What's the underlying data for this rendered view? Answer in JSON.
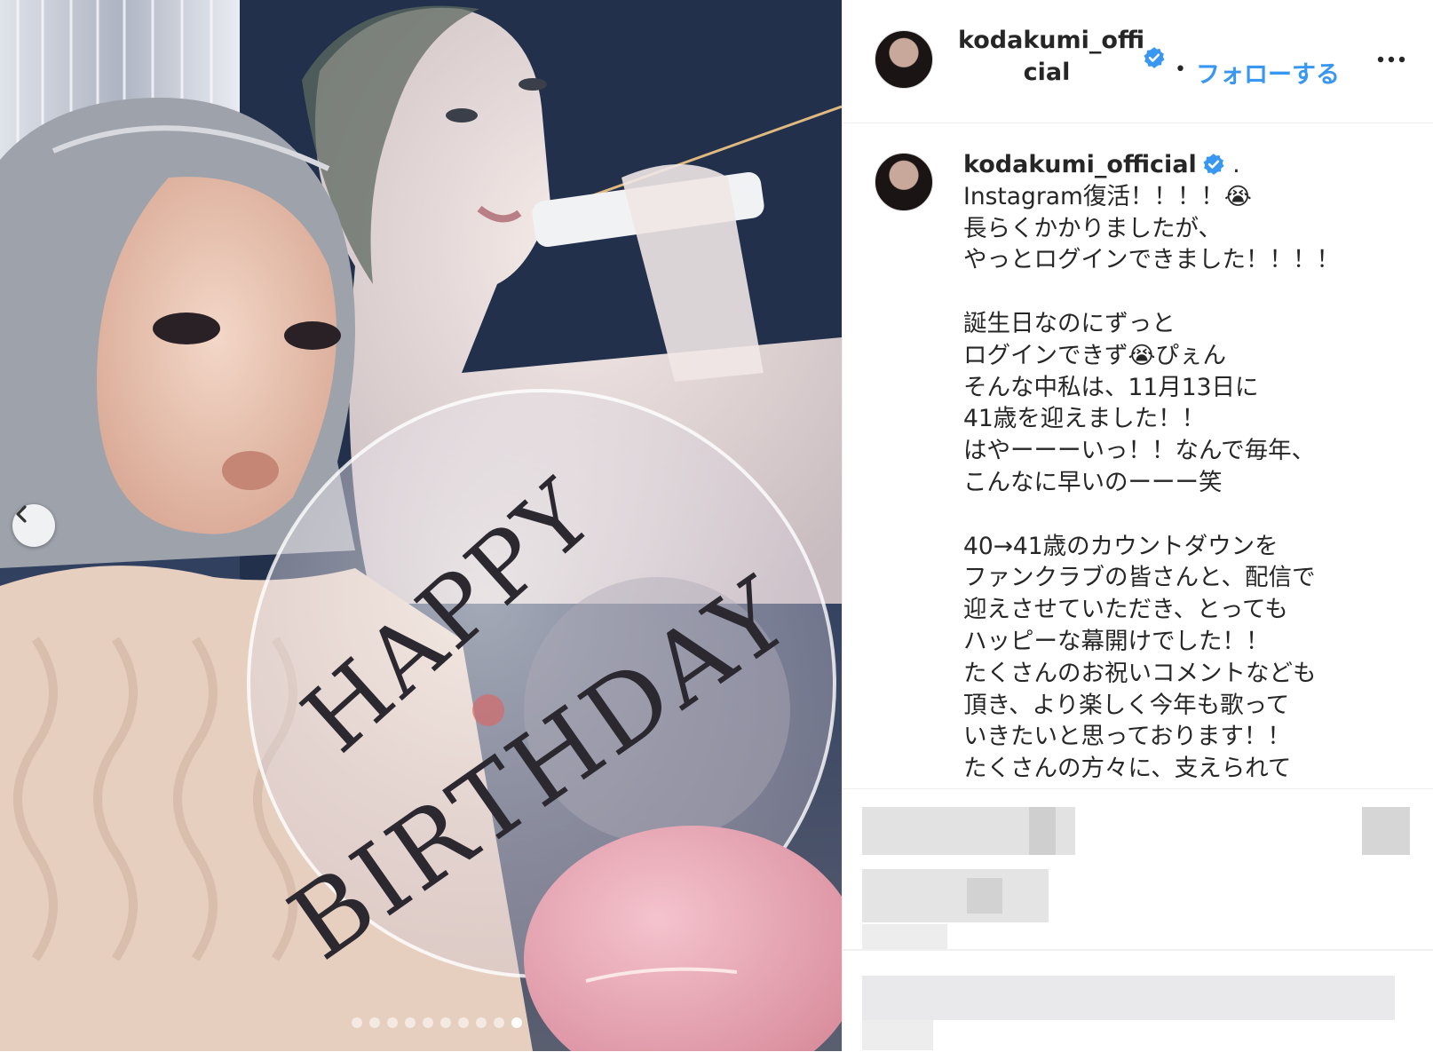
{
  "post": {
    "username_line1": "kodakumi_offi",
    "username_line2": "cial",
    "separator": "•",
    "follow_label": "フォローする",
    "more_label": "...",
    "caption_username": "kodakumi_official",
    "caption_suffix": " .",
    "caption_text": "Instagram復活！！！！😭\n長らくかかりましたが、\nやっとログインできました！！！！\n\n誕生日なのにずっと\nログインできず😭ぴぇん\nそんな中私は、11月13日に\n41歳を迎えました！！\nはやーーーいっ！！なんで毎年、\nこんなに早いのーーー笑\n\n40→41歳のカウントダウンを\nファンクラブの皆さんと、配信で\n迎えさせていただき、とっても\nハッピーな幕開けでした！！\nたくさんのお祝いコメントなども\n頂き、より楽しく今年も歌って\nいきたいと思っております！！\nたくさんの方々に、支えられて"
  },
  "media": {
    "balloon_line1": "HAPPY",
    "balloon_line2": "BIRTHDAY",
    "tiara_text": "HAPPY BIRTHDAY",
    "slide_count": 10,
    "active_slide": 10
  },
  "colors": {
    "accent": "#3897f0",
    "verified": "#3897f0",
    "text": "#262626"
  },
  "icons": {
    "prev": "chevron-left-icon",
    "verified": "verified-badge-icon",
    "more": "more-options-icon"
  }
}
